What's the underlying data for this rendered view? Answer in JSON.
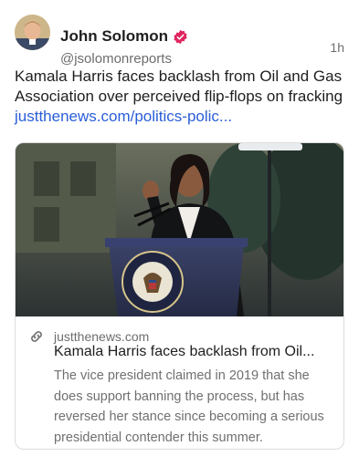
{
  "author": {
    "name": "John Solomon",
    "handle": "@jsolomonreports",
    "time": "1h",
    "verified_color": "#e0245e"
  },
  "post": {
    "text": "Kamala Harris faces backlash from Oil and Gas Association over perceived flip-flops on fracking ",
    "link_text": "justthenews.com/politics-polic..."
  },
  "card": {
    "domain": "justthenews.com",
    "title": "Kamala Harris faces backlash from Oil...",
    "description": "The vice president claimed in 2019 that she does support banning the process, but has reversed her stance since becoming a serious presidential contender this summer.",
    "image_alt": "Kamala Harris speaking at a podium with the vice presidential seal"
  },
  "colors": {
    "link": "#2a5ed8",
    "muted": "#707070",
    "podium": "#2f3656"
  },
  "icons": {
    "verified": "verified-badge-icon",
    "link": "link-icon"
  }
}
